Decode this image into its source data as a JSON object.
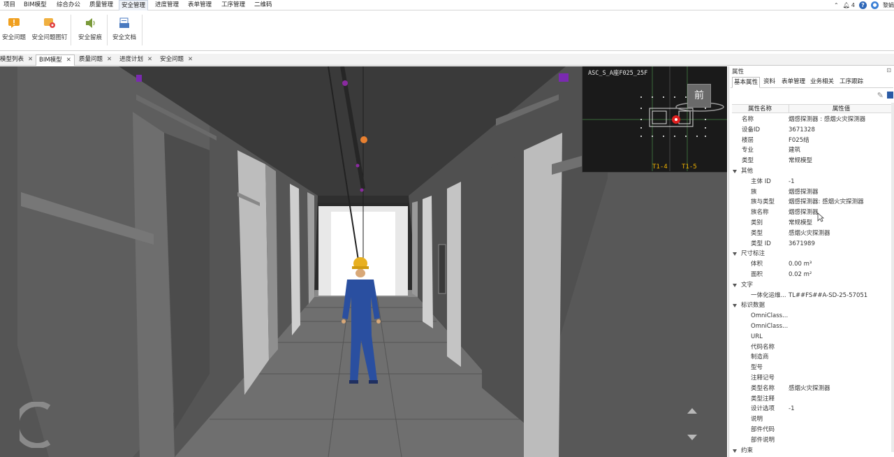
{
  "menu": {
    "items": [
      "项目",
      "BIM模型",
      "综合办公",
      "质量管理",
      "安全管理",
      "进度管理",
      "表单管理",
      "工序管理",
      "二维码"
    ],
    "active": "安全管理"
  },
  "tray": {
    "notification_count": "4",
    "help": "?",
    "user": "黎娟"
  },
  "ribbon": {
    "buttons": [
      "安全问题",
      "安全问题图钉",
      "安全留痕",
      "安全文档"
    ]
  },
  "doc_tabs": [
    "模型列表",
    "BIM模型",
    "质量问题",
    "进度计划",
    "安全问题"
  ],
  "doc_tab_active": "BIM模型",
  "minimap": {
    "title": "ASC_S_A座F025_25F",
    "grid_left": "T1-4",
    "grid_right": "T1-5",
    "view_cube": "前"
  },
  "properties": {
    "title": "属性",
    "tabs": [
      "基本属性",
      "资料",
      "表单管理",
      "业务相关",
      "工序跟踪"
    ],
    "tab_active": "基本属性",
    "col_name": "属性名称",
    "col_value": "属性值",
    "top_rows": [
      {
        "k": "名称",
        "v": "烟感探测器 : 感烟火灾探测器"
      },
      {
        "k": "设备ID",
        "v": "3671328"
      },
      {
        "k": "楼层",
        "v": "F025结"
      },
      {
        "k": "专业",
        "v": "建筑"
      },
      {
        "k": "类型",
        "v": "常规模型"
      }
    ],
    "groups": [
      {
        "label": "其他",
        "rows": [
          {
            "k": "主体 ID",
            "v": "-1"
          },
          {
            "k": "族",
            "v": "烟感探测器"
          },
          {
            "k": "族与类型",
            "v": "烟感探测器: 感烟火灾探测器"
          },
          {
            "k": "族名称",
            "v": "烟感探测器"
          },
          {
            "k": "类别",
            "v": "常规模型"
          },
          {
            "k": "类型",
            "v": "感烟火灾探测器"
          },
          {
            "k": "类型 ID",
            "v": "3671989"
          }
        ]
      },
      {
        "label": "尺寸标注",
        "rows": [
          {
            "k": "体积",
            "v": "0.00 m³"
          },
          {
            "k": "面积",
            "v": "0.02 m²"
          }
        ]
      },
      {
        "label": "文字",
        "rows": [
          {
            "k": "一体化运维...",
            "v": "TL##FS##A-SD-25-57051"
          }
        ]
      },
      {
        "label": "标识数据",
        "rows": [
          {
            "k": "OmniClass...",
            "v": ""
          },
          {
            "k": "OmniClass...",
            "v": ""
          },
          {
            "k": "URL",
            "v": ""
          },
          {
            "k": "代码名称",
            "v": ""
          },
          {
            "k": "制造商",
            "v": ""
          },
          {
            "k": "型号",
            "v": ""
          },
          {
            "k": "注释记号",
            "v": ""
          },
          {
            "k": "类型名称",
            "v": "感烟火灾探测器"
          },
          {
            "k": "类型注释",
            "v": ""
          },
          {
            "k": "设计选项",
            "v": "-1"
          },
          {
            "k": "说明",
            "v": ""
          },
          {
            "k": "部件代码",
            "v": ""
          },
          {
            "k": "部件说明",
            "v": ""
          }
        ]
      },
      {
        "label": "约束",
        "rows": []
      }
    ]
  },
  "colors": {
    "accent": "#2e67b8",
    "grid_label": "#f3b400",
    "selection": "#e02020"
  }
}
